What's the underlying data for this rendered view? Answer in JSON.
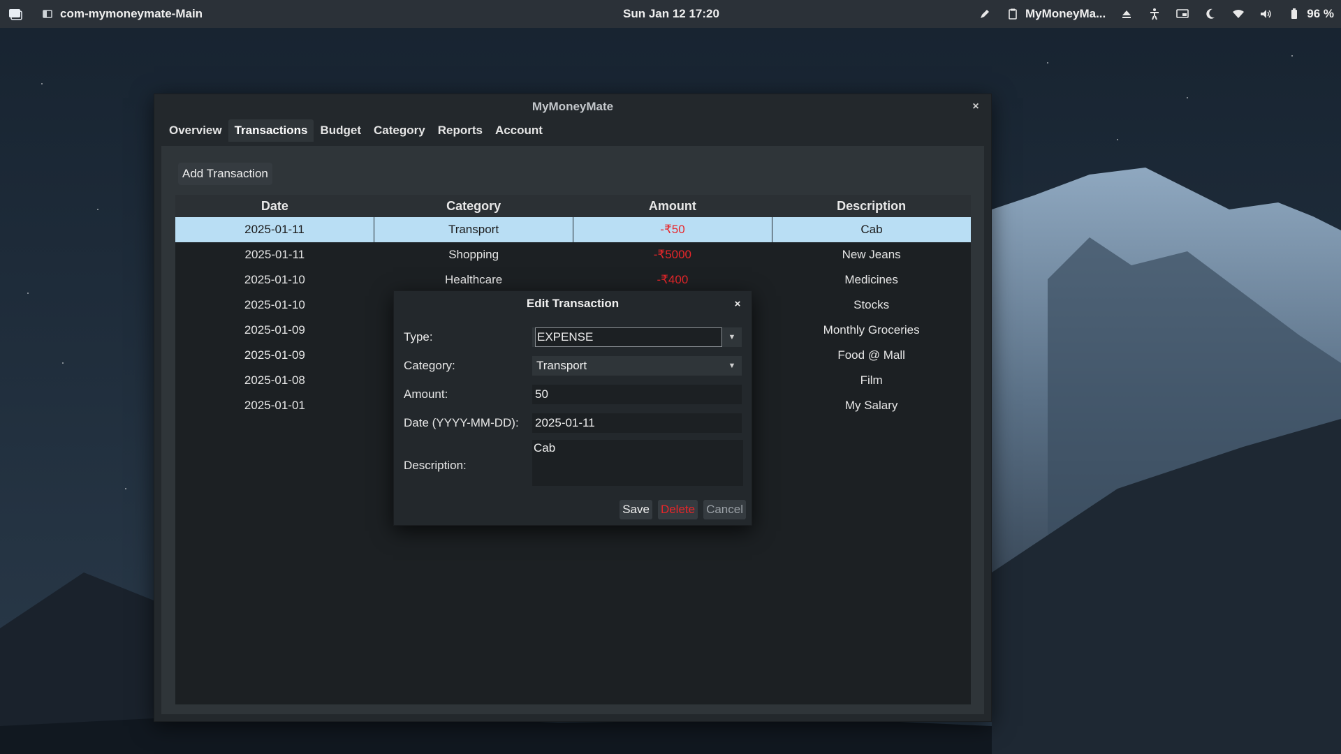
{
  "topbar": {
    "app_label": "com-mymoneymate-Main",
    "clock": "Sun Jan 12  17:20",
    "window_label": "MyMoneyMa...",
    "battery": "96 %"
  },
  "window": {
    "title": "MyMoneyMate",
    "close": "×",
    "tabs": [
      "Overview",
      "Transactions",
      "Budget",
      "Category",
      "Reports",
      "Account"
    ],
    "active_tab": "Transactions",
    "add_button": "Add Transaction"
  },
  "table": {
    "columns": [
      "Date",
      "Category",
      "Amount",
      "Description"
    ],
    "rows": [
      {
        "date": "2025-01-11",
        "category": "Transport",
        "amount": "-₹50",
        "description": "Cab",
        "selected": true
      },
      {
        "date": "2025-01-11",
        "category": "Shopping",
        "amount": "-₹5000",
        "description": "New Jeans"
      },
      {
        "date": "2025-01-10",
        "category": "Healthcare",
        "amount": "-₹400",
        "description": "Medicines"
      },
      {
        "date": "2025-01-10",
        "category": "",
        "amount": "",
        "description": "Stocks"
      },
      {
        "date": "2025-01-09",
        "category": "",
        "amount": "",
        "description": "Monthly Groceries"
      },
      {
        "date": "2025-01-09",
        "category": "",
        "amount": "",
        "description": "Food @ Mall"
      },
      {
        "date": "2025-01-08",
        "category": "",
        "amount": "",
        "description": "Film"
      },
      {
        "date": "2025-01-01",
        "category": "",
        "amount": "",
        "description": "My Salary"
      }
    ]
  },
  "dialog": {
    "title": "Edit Transaction",
    "close": "×",
    "type_label": "Type:",
    "type_value": "EXPENSE",
    "category_label": "Category:",
    "category_value": "Transport",
    "amount_label": "Amount:",
    "amount_value": "50",
    "date_label": "Date (YYYY-MM-DD):",
    "date_value": "2025-01-11",
    "description_label": "Description:",
    "description_value": "Cab",
    "save": "Save",
    "delete": "Delete",
    "cancel": "Cancel"
  },
  "colors": {
    "negative_amount": "#e8262a",
    "selection": "#b9def4"
  }
}
